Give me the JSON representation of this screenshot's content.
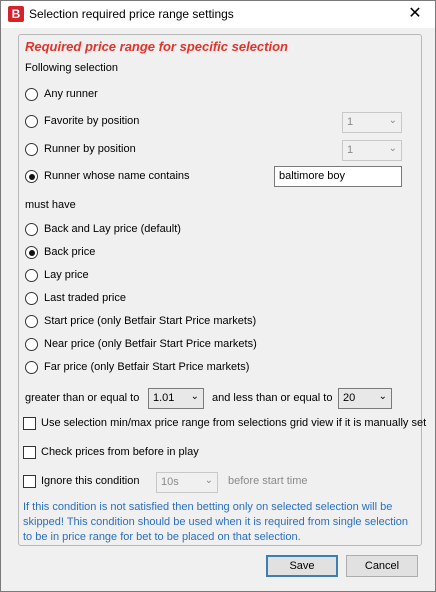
{
  "window": {
    "title": "Selection required price range settings",
    "app_icon_letter": "B"
  },
  "panel": {
    "title": "Required price range for specific selection",
    "following_selection_label": "Following selection",
    "selection_options": [
      {
        "label": "Any runner",
        "checked": false
      },
      {
        "label": "Favorite by position",
        "checked": false
      },
      {
        "label": "Runner by position",
        "checked": false
      },
      {
        "label": "Runner whose name contains",
        "checked": true
      }
    ],
    "favorite_position_value": "1",
    "runner_position_value": "1",
    "name_contains_value": "baltimore boy",
    "must_have_label": "must have",
    "price_options": [
      {
        "label": "Back and Lay price (default)",
        "checked": false
      },
      {
        "label": "Back price",
        "checked": true
      },
      {
        "label": "Lay price",
        "checked": false
      },
      {
        "label": "Last traded price",
        "checked": false
      },
      {
        "label": "Start price (only Betfair Start Price markets)",
        "checked": false
      },
      {
        "label": "Near price (only Betfair Start Price markets)",
        "checked": false
      },
      {
        "label": "Far price (only Betfair Start Price markets)",
        "checked": false
      }
    ],
    "gte_label": "greater than or equal to",
    "gte_value": "1.01",
    "lte_label": "and less than or equal to",
    "lte_value": "20",
    "use_minmax_label": "Use selection min/max price range from selections grid view if it is manually set",
    "check_prices_label": "Check prices from before in play",
    "ignore_condition_label": "Ignore this condition",
    "ignore_time_value": "10s",
    "before_start_label": "before start time",
    "info_text": "If this condition is not satisfied then betting only on selected selection will be skipped! This condition should be used when it is required from single selection to be in price range for bet to be placed on that selection."
  },
  "buttons": {
    "save": "Save",
    "cancel": "Cancel"
  },
  "colors": {
    "accent_red": "#e0342b",
    "info_blue": "#2a6fc1",
    "default_button_border": "#3c7fb1"
  }
}
